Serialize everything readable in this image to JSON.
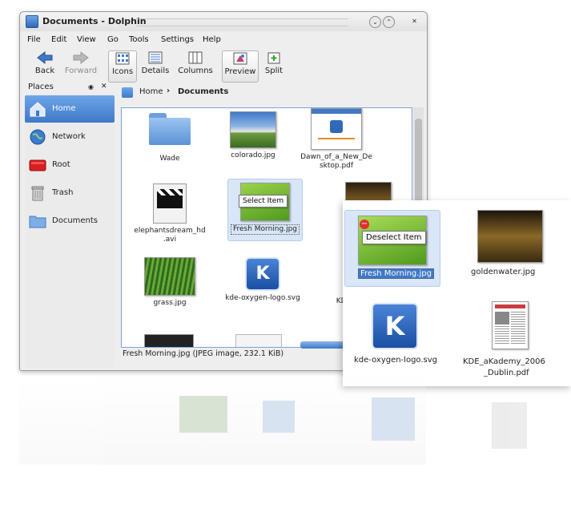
{
  "window": {
    "title": "Documents - Dolphin",
    "minimize": "⌄",
    "maximize": "⌃",
    "close": "✕"
  },
  "menu": [
    "File",
    "Edit",
    "View",
    "Go",
    "Tools",
    "Settings",
    "Help"
  ],
  "toolbar": {
    "back": "Back",
    "forward": "Forward",
    "icons": "Icons",
    "details": "Details",
    "columns": "Columns",
    "preview": "Preview",
    "split": "Split"
  },
  "places": {
    "title": "Places",
    "items": [
      {
        "label": "Home",
        "selected": true
      },
      {
        "label": "Network"
      },
      {
        "label": "Root"
      },
      {
        "label": "Trash"
      },
      {
        "label": "Documents"
      }
    ]
  },
  "breadcrumb": {
    "home": "Home",
    "sep": "›",
    "current": "Documents"
  },
  "files": [
    {
      "name": "Wade"
    },
    {
      "name": "colorado.jpg"
    },
    {
      "name": "Dawn_of_a_New_Desktop.pdf",
      "line1": "Dawn_of_a_New_De",
      "line2": "sktop.pdf"
    },
    {
      "name": "elephantsdream_hd.avi",
      "line1": "elephantsdream_hd",
      "line2": ".avi"
    },
    {
      "name": "Fresh Morning.jpg"
    },
    {
      "name": "goldenwater.jpg",
      "short": "gold"
    },
    {
      "name": "grass.jpg"
    },
    {
      "name": "kde-oxygen-logo.svg"
    },
    {
      "name": "KDE_aKademy_2006_Dublin.pdf",
      "short": "KDE_a"
    }
  ],
  "tooltips": {
    "select": "Select Item",
    "deselect": "Deselect Item"
  },
  "status": {
    "text": "Fresh Morning.jpg (JPEG image, 232.1 KiB)"
  },
  "zoom": {
    "fresh": "Fresh Morning.jpg",
    "golden": "goldenwater.jpg",
    "kde_logo": "kde-oxygen-logo.svg",
    "kde_pdf_line1": "KDE_aKademy_2006",
    "kde_pdf_line2": "_Dublin.pdf"
  },
  "colors": {
    "accent": "#3f79c8",
    "selection": "#6ea5e7"
  },
  "icons": [
    "arrow-left-icon",
    "arrow-right-icon",
    "grid-icon",
    "details-icon",
    "columns-icon",
    "preview-icon",
    "split-icon",
    "home-icon",
    "globe-icon",
    "drive-icon",
    "trash-icon",
    "folder-icon"
  ]
}
